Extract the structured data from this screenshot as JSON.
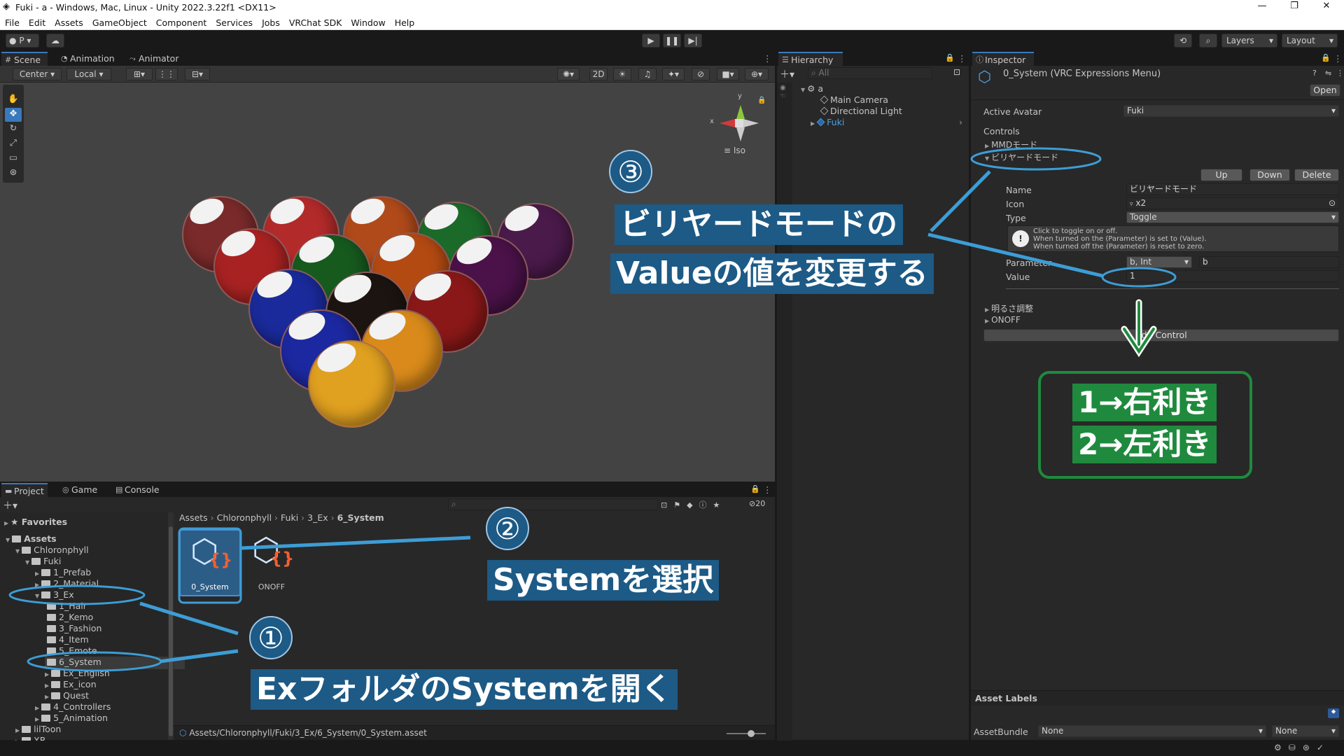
{
  "window": {
    "title": "Fuki - a - Windows, Mac, Linux - Unity 2022.3.22f1 <DX11>"
  },
  "menu": [
    "File",
    "Edit",
    "Assets",
    "GameObject",
    "Component",
    "Services",
    "Jobs",
    "VRChat SDK",
    "Window",
    "Help"
  ],
  "toolbar": {
    "account": "P",
    "layers": "Layers",
    "layout": "Layout"
  },
  "scene_tabs": [
    "Scene",
    "Animation",
    "Animator"
  ],
  "scene_toolbar": {
    "pivot": "Center",
    "space": "Local",
    "mode2d": "2D",
    "iso": "Iso",
    "axis_x": "x",
    "axis_y": "y"
  },
  "hierarchy": {
    "title": "Hierarchy",
    "search_placeholder": "All",
    "root": "a",
    "items": [
      "Main Camera",
      "Directional Light",
      "Fuki"
    ]
  },
  "inspector": {
    "title": "Inspector",
    "object_name": "0_System (VRC Expressions Menu)",
    "open": "Open",
    "active_avatar_label": "Active Avatar",
    "active_avatar_value": "Fuki",
    "controls_label": "Controls",
    "controls": [
      "MMDモード",
      "ビリヤードモード"
    ],
    "buttons": {
      "up": "Up",
      "down": "Down",
      "delete": "Delete"
    },
    "name_label": "Name",
    "name_value": "ビリヤードモード",
    "icon_label": "Icon",
    "icon_value": "x2",
    "type_label": "Type",
    "type_value": "Toggle",
    "help_lines": [
      "Click to toggle on or off.",
      "When turned on the (Parameter) is set to (Value).",
      "When turned off the (Parameter) is reset to zero."
    ],
    "param_label": "Parameter",
    "param_type": "b, Int",
    "param_name": "b",
    "value_label": "Value",
    "value_value": "1",
    "more_controls": [
      "明るさ調整",
      "ONOFF"
    ],
    "add_control": "Add Control",
    "asset_labels": "Asset Labels",
    "asset_bundle_label": "AssetBundle",
    "asset_bundle_value": "None",
    "asset_bundle_variant": "None"
  },
  "bottom_tabs": [
    "Project",
    "Game",
    "Console"
  ],
  "project": {
    "hidden_count": "20",
    "favorites": "Favorites",
    "tree": [
      {
        "label": "Assets",
        "indent": 0,
        "bold": true
      },
      {
        "label": "Chloronphyll",
        "indent": 1
      },
      {
        "label": "Fuki",
        "indent": 2
      },
      {
        "label": "1_Prefab",
        "indent": 3
      },
      {
        "label": "2_Material",
        "indent": 3
      },
      {
        "label": "3_Ex",
        "indent": 3
      },
      {
        "label": "1_Hair",
        "indent": 4
      },
      {
        "label": "2_Kemo",
        "indent": 4
      },
      {
        "label": "3_Fashion",
        "indent": 4
      },
      {
        "label": "4_Item",
        "indent": 4
      },
      {
        "label": "5_Emote",
        "indent": 4
      },
      {
        "label": "6_System",
        "indent": 4
      },
      {
        "label": "Ex_English",
        "indent": 4
      },
      {
        "label": "Ex_icon",
        "indent": 4
      },
      {
        "label": "Quest",
        "indent": 4
      },
      {
        "label": "4_Controllers",
        "indent": 3
      },
      {
        "label": "5_Animation",
        "indent": 3
      },
      {
        "label": "lilToon",
        "indent": 1
      },
      {
        "label": "XR",
        "indent": 1
      }
    ],
    "breadcrumb": [
      "Assets",
      "Chloronphyll",
      "Fuki",
      "3_Ex",
      "6_System"
    ],
    "assets": [
      "0_System",
      "ONOFF"
    ],
    "footer_path": "Assets/Chloronphyll/Fuki/3_Ex/6_System/0_System.asset"
  },
  "annotations": {
    "step1_num": "①",
    "step1_text": "Exフォルダ​のSystemを開く",
    "step2_num": "②",
    "step2_text": "Systemを選択",
    "step3_num": "③",
    "step3_line1": "ビリヤードモードの",
    "step3_line2": "Valueの値を変更する",
    "note_line1": "1→右利き",
    "note_line2": "2→左利き"
  },
  "colors": {
    "accent": "#3a79bb",
    "annotation_blue": "#1d5a86",
    "annotation_green": "#1f8a3d",
    "selection_text": "#4aa0e6"
  }
}
